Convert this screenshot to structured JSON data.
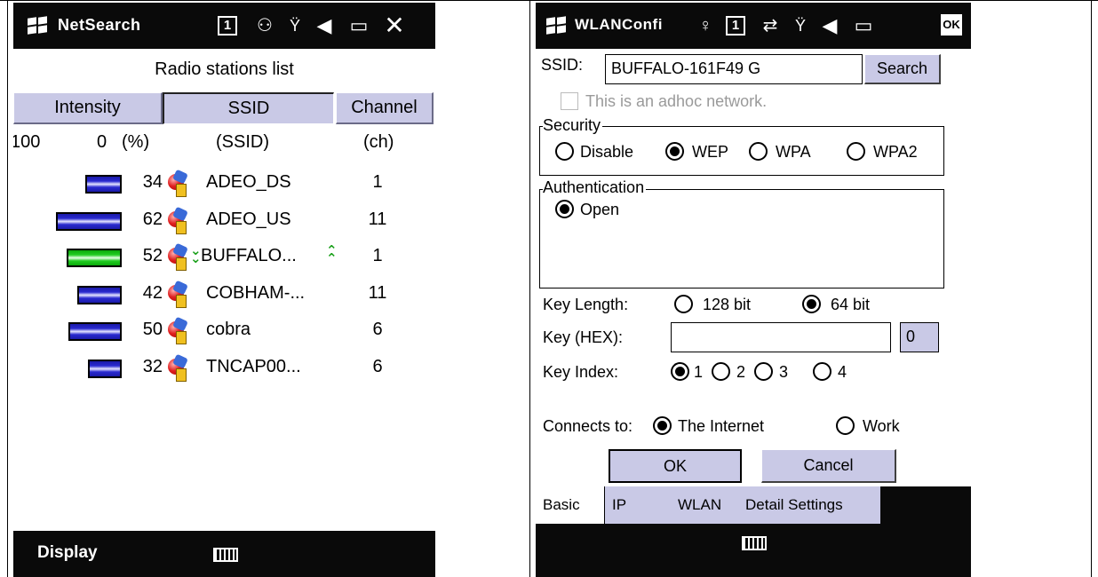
{
  "netsearch": {
    "title": "NetSearch",
    "notif_count": "1",
    "heading": "Radio stations list",
    "columns": {
      "intensity": "Intensity",
      "ssid": "SSID",
      "channel": "Channel"
    },
    "units": {
      "max": "100",
      "min": "0",
      "pct": "(%)",
      "ssid": "(SSID)",
      "ch": "(ch)"
    },
    "stations": [
      {
        "signal": 34,
        "ssid": "ADEO_DS",
        "channel": "1",
        "connected": false
      },
      {
        "signal": 62,
        "ssid": "ADEO_US",
        "channel": "11",
        "connected": false
      },
      {
        "signal": 52,
        "ssid": "BUFFALO...",
        "channel": "1",
        "connected": true
      },
      {
        "signal": 42,
        "ssid": "COBHAM-...",
        "channel": "11",
        "connected": false
      },
      {
        "signal": 50,
        "ssid": "cobra",
        "channel": "6",
        "connected": false
      },
      {
        "signal": 32,
        "ssid": "TNCAP00...",
        "channel": "6",
        "connected": false
      }
    ],
    "menu": {
      "left": "Display"
    },
    "colors": {
      "signal_bar": "#2a2ad0",
      "connected_bar": "#22cc22",
      "header_bg": "#c9c9e6"
    },
    "icons": [
      "windows-flag-icon",
      "notification-icon",
      "connectivity-icon",
      "signal-icon",
      "speaker-icon",
      "battery-icon",
      "close-icon",
      "access-point-icon",
      "keyboard-icon"
    ]
  },
  "wlanconfig": {
    "title": "WLANConfi",
    "notif_count": "1",
    "ok_badge": "OK",
    "ssid_label": "SSID:",
    "ssid_value": "BUFFALO-161F49  G",
    "search_button": "Search",
    "adhoc_label": "This is an adhoc network.",
    "adhoc_checked": false,
    "security": {
      "title": "Security",
      "options": [
        "Disable",
        "WEP",
        "WPA",
        "WPA2"
      ],
      "selected": "WEP"
    },
    "authentication": {
      "title": "Authentication",
      "options": [
        "Open"
      ],
      "selected": "Open"
    },
    "key_length": {
      "label": "Key Length:",
      "options": [
        "128 bit",
        "64 bit"
      ],
      "selected": "64 bit"
    },
    "key_hex": {
      "label": "Key (HEX):",
      "value": "",
      "counter": "0"
    },
    "key_index": {
      "label": "Key Index:",
      "options": [
        "1",
        "2",
        "3",
        "4"
      ],
      "selected": "1"
    },
    "connects_to": {
      "label": "Connects to:",
      "options": [
        "The Internet",
        "Work"
      ],
      "selected": "The Internet"
    },
    "buttons": {
      "ok": "OK",
      "cancel": "Cancel"
    },
    "tabs": [
      "Basic",
      "IP",
      "WLAN",
      "Detail Settings"
    ],
    "active_tab": "Basic",
    "icons": [
      "windows-flag-icon",
      "antenna-icon",
      "notification-icon",
      "sync-icon",
      "signal-icon",
      "speaker-icon",
      "battery-icon",
      "keyboard-icon"
    ]
  }
}
